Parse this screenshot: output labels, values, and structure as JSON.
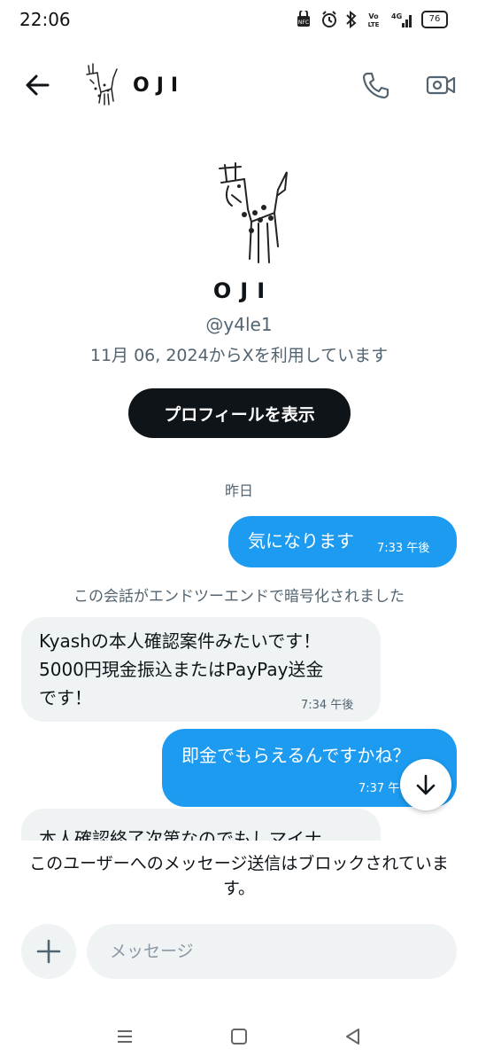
{
  "status_bar": {
    "time": "22:06",
    "battery": "76",
    "icons": [
      "nfc-icon",
      "alarm-icon",
      "bluetooth-icon",
      "volte-icon",
      "4g-signal-icon",
      "battery-icon"
    ]
  },
  "header": {
    "name": "OJI",
    "icons": [
      "back-arrow-icon",
      "avatar-giraffe",
      "phone-icon",
      "video-icon"
    ]
  },
  "profile": {
    "name": "OJI",
    "handle": "@y4le1",
    "joined": "11月 06, 2024からXを利用しています",
    "button_label": "プロフィールを表示"
  },
  "conversation": {
    "day_label": "昨日",
    "encryption_note": "この会話がエンドツーエンドで暗号化されました",
    "messages": [
      {
        "direction": "out",
        "text": "気になります",
        "time": "7:33 午後"
      },
      {
        "direction": "in",
        "text": "Kyashの本人確認案件みたいです！\n5000円現金振込またはPayPay送金\nです！",
        "time": "7:34 午後"
      },
      {
        "direction": "out",
        "text": "即金でもらえるんですかね？",
        "time": "7:37 午後"
      },
      {
        "direction": "in",
        "text": "本人確認終了次第なのでもしマイナ",
        "time": ""
      }
    ]
  },
  "composer": {
    "blocked_note": "このユーザーへのメッセージ送信はブロックされています。",
    "placeholder": "メッセージ"
  },
  "colors": {
    "accent": "#1d9bf0",
    "incoming_bubble": "#eff3f4",
    "text": "#0f1419",
    "secondary_text": "#536471"
  }
}
